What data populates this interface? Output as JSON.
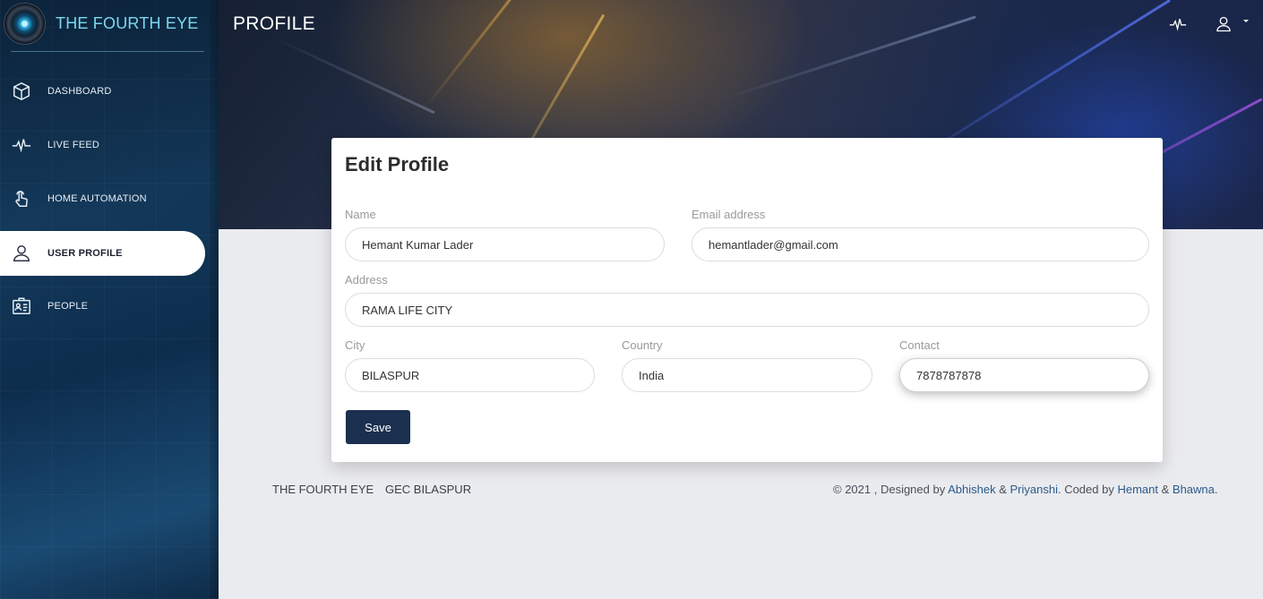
{
  "brand": {
    "title": "THE FOURTH EYE"
  },
  "sidebar": {
    "items": [
      {
        "label": "DASHBOARD",
        "icon": "cube-icon"
      },
      {
        "label": "LIVE FEED",
        "icon": "pulse-icon"
      },
      {
        "label": "HOME AUTOMATION",
        "icon": "touch-hand-icon"
      },
      {
        "label": "USER PROFILE",
        "icon": "user-icon",
        "active": true
      },
      {
        "label": "PEOPLE",
        "icon": "id-card-icon"
      }
    ]
  },
  "header": {
    "page_title": "PROFILE",
    "icons": [
      "pulse-icon",
      "user-icon",
      "caret-down-icon"
    ]
  },
  "form": {
    "title": "Edit Profile",
    "name": {
      "label": "Name",
      "value": "Hemant Kumar Lader"
    },
    "email": {
      "label": "Email address",
      "value": "hemantlader@gmail.com"
    },
    "address": {
      "label": "Address",
      "value": "RAMA LIFE CITY"
    },
    "city": {
      "label": "City",
      "value": "BILASPUR"
    },
    "country": {
      "label": "Country",
      "value": "India"
    },
    "contact": {
      "label": "Contact",
      "value": "7878787878"
    },
    "save_label": "Save"
  },
  "footer": {
    "links": [
      "THE FOURTH EYE",
      "GEC BILASPUR"
    ],
    "copyright_prefix": "© 2021 , Designed by ",
    "designer1": "Abhishek",
    "amp1": " & ",
    "designer2": "Priyanshi",
    "coded_by": ". Coded by ",
    "coder1": "Hemant",
    "amp2": " & ",
    "coder2": "Bhawna",
    "suffix": "."
  },
  "colors": {
    "brand_text": "#7ad8f0",
    "save_button": "#1b2f4f",
    "page_background": "#eaebef",
    "link": "#2b5a8a"
  }
}
